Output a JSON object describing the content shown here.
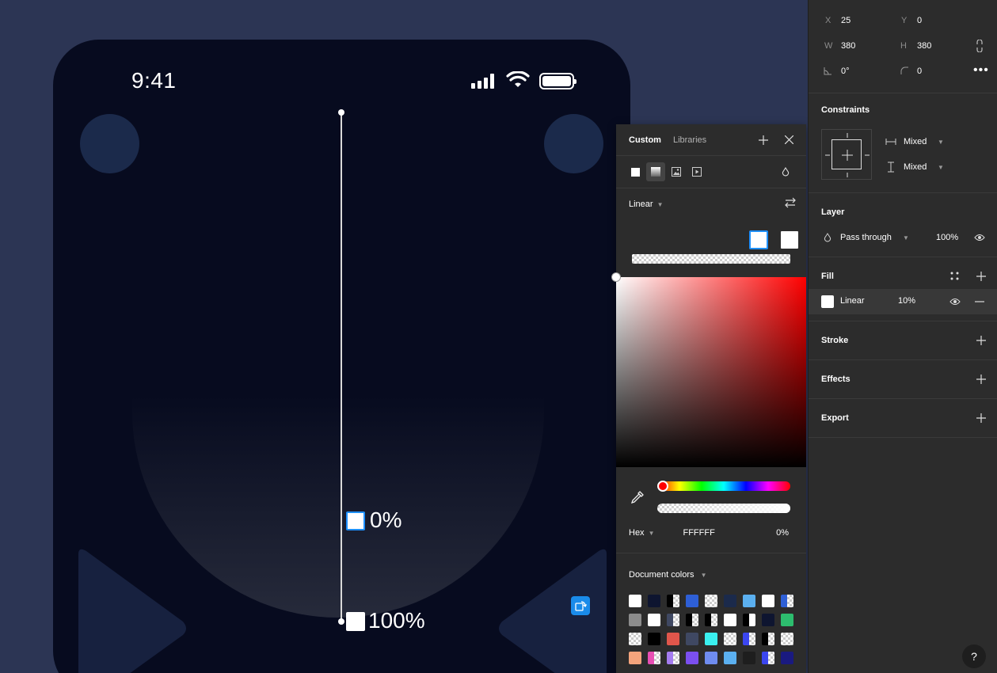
{
  "phone": {
    "time": "9:41"
  },
  "gradient_stops": {
    "top_label": "0%",
    "bottom_label": "100%"
  },
  "picker": {
    "tabs": [
      "Custom",
      "Libraries"
    ],
    "fill_types": [
      "solid-fill",
      "gradient-fill",
      "image-fill",
      "video-fill"
    ],
    "mode": "Linear",
    "hex_label": "Hex",
    "hex_value": "FFFFFF",
    "opacity": "0%",
    "document_colors_label": "Document colors",
    "swatches": [
      {
        "c": "#ffffff"
      },
      {
        "c": "#0e1530"
      },
      {
        "c": "#000000",
        "h": "checker"
      },
      {
        "c": "#2e5fd6"
      },
      {
        "c": "checker"
      },
      {
        "c": "#1b2a4b"
      },
      {
        "c": "#5bb0f0"
      },
      {
        "c": "#ffffff"
      },
      {
        "c": "#2e5fd6",
        "h": "checker"
      },
      {
        "c": "#8c8c8c"
      },
      {
        "c": "#ffffff"
      },
      {
        "c": "#3f4862",
        "h": "checker"
      },
      {
        "c": "#000000",
        "h": "checker"
      },
      {
        "c": "#000000",
        "h": "checker"
      },
      {
        "c": "#ffffff"
      },
      {
        "c": "#000000",
        "h": "#ffffff"
      },
      {
        "c": "#0e1530"
      },
      {
        "c": "#2dbd6e"
      },
      {
        "c": "checker"
      },
      {
        "c": "#000000"
      },
      {
        "c": "#e0564b"
      },
      {
        "c": "#3f4862"
      },
      {
        "c": "#3af0f0"
      },
      {
        "c": "checker"
      },
      {
        "c": "#3b46f0",
        "h": "checker"
      },
      {
        "c": "#000000",
        "h": "checker"
      },
      {
        "c": "checker"
      },
      {
        "c": "#f4a47c"
      },
      {
        "c": "#e84fb4",
        "h": "checker"
      },
      {
        "c": "#a47cf0",
        "h": "checker"
      },
      {
        "c": "#7b4ff0"
      },
      {
        "c": "#6f8cf0"
      },
      {
        "c": "#5bb0f0"
      },
      {
        "c": "#1e1e1e"
      },
      {
        "c": "#3b46f0",
        "h": "checker"
      },
      {
        "c": "#1a1a80"
      }
    ]
  },
  "inspector": {
    "x_label": "X",
    "x_value": "25",
    "y_label": "Y",
    "y_value": "0",
    "w_label": "W",
    "w_value": "380",
    "h_label": "H",
    "h_value": "380",
    "rotation": "0°",
    "radius": "0",
    "constraints_title": "Constraints",
    "constraint_h": "Mixed",
    "constraint_v": "Mixed",
    "layer_title": "Layer",
    "blend_mode": "Pass through",
    "layer_opacity": "100%",
    "fill_title": "Fill",
    "fill_type": "Linear",
    "fill_opacity": "10%",
    "stroke_title": "Stroke",
    "effects_title": "Effects",
    "export_title": "Export",
    "help": "?"
  }
}
